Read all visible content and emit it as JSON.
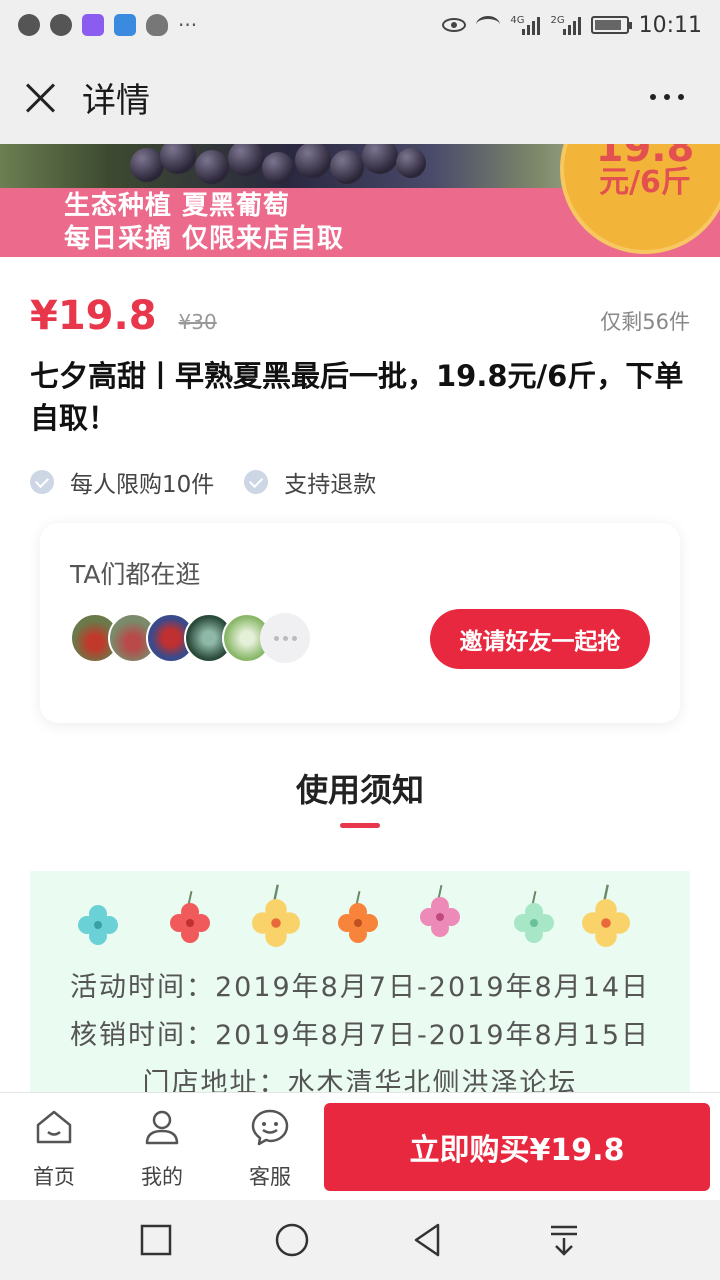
{
  "status_bar": {
    "time": "10:11",
    "signal1_label": "4G",
    "signal2_label": "2G"
  },
  "navbar": {
    "title": "详情"
  },
  "banner": {
    "line1": "生态种植  夏黑葡萄",
    "line2": "每日采摘  仅限来店自取",
    "badge_price": "19.8",
    "badge_unit": "元/6斤"
  },
  "product": {
    "price": "¥19.8",
    "original_price": "¥30",
    "remaining": "仅剩56件",
    "title": "七夕高甜丨早熟夏黑最后一批，19.8元/6斤，下单自取！",
    "tags": [
      "每人限购10件",
      "支持退款"
    ]
  },
  "social_card": {
    "title": "TA们都在逛",
    "invite_button": "邀请好友一起抢"
  },
  "notice": {
    "title": "使用须知",
    "activity_time": "活动时间：2019年8月7日-2019年8月14日",
    "redeem_time": "核销时间：2019年8月7日-2019年8月15日",
    "address": "门店地址：水木清华北侧洪泽论坛"
  },
  "action_bar": {
    "home_label": "首页",
    "mine_label": "我的",
    "service_label": "客服",
    "buy_button": "立即购买¥19.8"
  },
  "colors": {
    "accent_red": "#e8283f",
    "price_red": "#e8364a",
    "banner_pink": "#ec6b8c",
    "notice_bg": "#eafbf1"
  }
}
